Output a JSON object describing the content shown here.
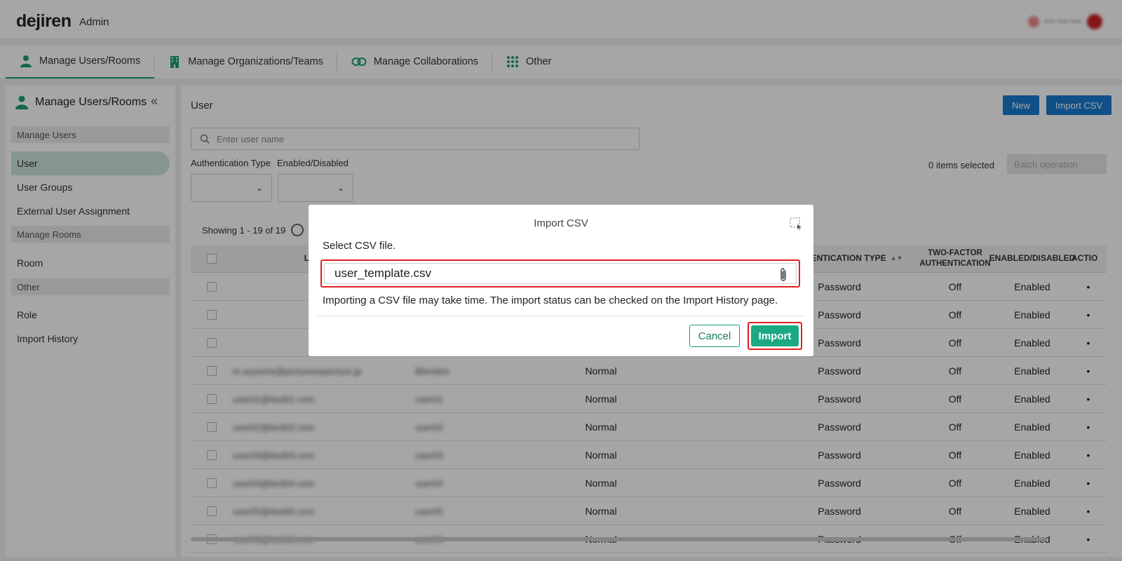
{
  "header": {
    "logo": "dejiren",
    "app_label": "Admin"
  },
  "nav": {
    "tabs": [
      {
        "label": "Manage Users/Rooms",
        "icon": "person-icon"
      },
      {
        "label": "Manage Organizations/Teams",
        "icon": "building-icon"
      },
      {
        "label": "Manage Collaborations",
        "icon": "link-icon"
      },
      {
        "label": "Other",
        "icon": "grid-icon"
      }
    ]
  },
  "sidebar": {
    "title": "Manage Users/Rooms",
    "sections": [
      {
        "label": "Manage Users",
        "items": [
          "User",
          "User Groups",
          "External User Assignment"
        ]
      },
      {
        "label": "Manage Rooms",
        "items": [
          "Room"
        ]
      },
      {
        "label": "Other",
        "items": [
          "Role",
          "Import History"
        ]
      }
    ],
    "active_item": "User"
  },
  "main": {
    "title": "User",
    "new_button": "New",
    "import_button": "Import CSV",
    "search_placeholder": "Enter user name",
    "filters": {
      "auth_type_label": "Authentication Type",
      "enabled_label": "Enabled/Disabled"
    },
    "items_selected": "0 items selected",
    "batch_button": "Batch operation",
    "showing": "Showing 1 - 19 of 19"
  },
  "table": {
    "headers": {
      "login": "LO",
      "auth_type": "THENTICATION TYPE",
      "two_factor": "TWO-FACTOR AUTHENTICATION",
      "enabled": "ENABLED/DISABLED",
      "action": "ACTIO"
    },
    "rows": [
      {
        "login": "",
        "name": "",
        "type": "",
        "auth": "Password",
        "tfa": "Off",
        "status": "Enabled"
      },
      {
        "login": "",
        "name": "",
        "type": "",
        "auth": "Password",
        "tfa": "Off",
        "status": "Enabled"
      },
      {
        "login": "",
        "name": "",
        "type": "",
        "auth": "Password",
        "tfa": "Off",
        "status": "Enabled"
      },
      {
        "login": "m.aoyama@pictureaspecture.jp",
        "name": "Blended",
        "type": "Normal",
        "auth": "Password",
        "tfa": "Off",
        "status": "Enabled"
      },
      {
        "login": "user01@test01.com",
        "name": "user01",
        "type": "Normal",
        "auth": "Password",
        "tfa": "Off",
        "status": "Enabled"
      },
      {
        "login": "user02@test02.com",
        "name": "user02",
        "type": "Normal",
        "auth": "Password",
        "tfa": "Off",
        "status": "Enabled"
      },
      {
        "login": "user03@test03.com",
        "name": "user03",
        "type": "Normal",
        "auth": "Password",
        "tfa": "Off",
        "status": "Enabled"
      },
      {
        "login": "user04@test04.com",
        "name": "user04",
        "type": "Normal",
        "auth": "Password",
        "tfa": "Off",
        "status": "Enabled"
      },
      {
        "login": "user05@test05.com",
        "name": "user05",
        "type": "Normal",
        "auth": "Password",
        "tfa": "Off",
        "status": "Enabled"
      },
      {
        "login": "user06@test06.com",
        "name": "user06",
        "type": "Normal",
        "auth": "Password",
        "tfa": "Off",
        "status": "Enabled"
      }
    ]
  },
  "modal": {
    "title": "Import CSV",
    "label": "Select CSV file.",
    "file_value": "user_template.csv",
    "note": "Importing a CSV file may take time. The import status can be checked on the Import History page.",
    "cancel_button": "Cancel",
    "import_button": "Import"
  },
  "colors": {
    "accent": "#1aa982",
    "brand_blue": "#1a7bd1",
    "highlight": "#e0201f"
  }
}
